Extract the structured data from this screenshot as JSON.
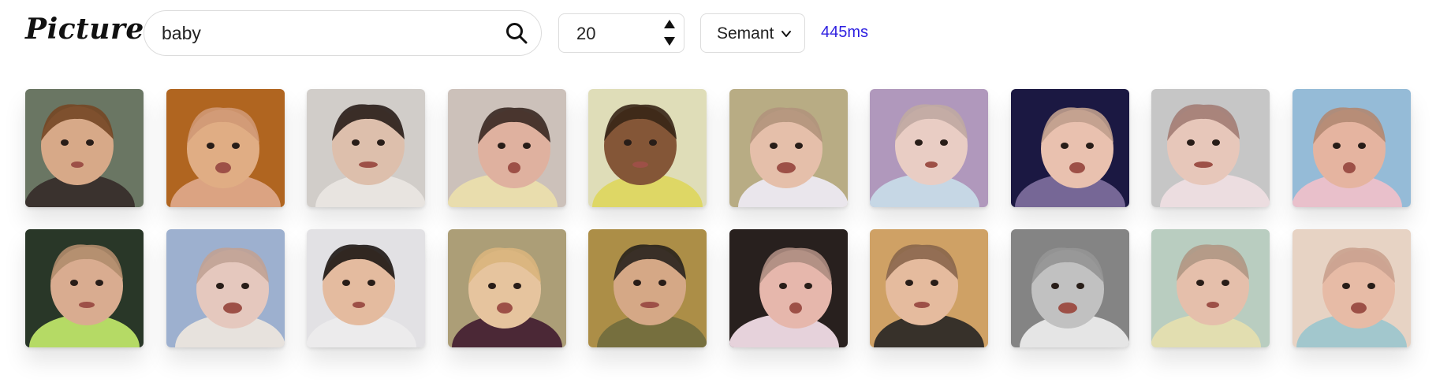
{
  "app": {
    "title": "Pictures"
  },
  "search": {
    "query": "baby",
    "icon": "search-icon"
  },
  "count": {
    "value": "20"
  },
  "mode_select": {
    "selected": "Semant"
  },
  "timing": {
    "text": "445ms",
    "color": "#2d1fe0"
  },
  "results": [
    {
      "bg": "#6f7b68",
      "skin": "#e0b08e",
      "hair": "#7a4a26",
      "cloth": "#3d3530"
    },
    {
      "bg": "#b86a22",
      "skin": "#eab58a",
      "hair": "#d9a07a",
      "cloth": "#e4aa88"
    },
    {
      "bg": "#dad6d2",
      "skin": "#e6c7b3",
      "hair": "#2a1e1a",
      "cloth": "#f2eeea"
    },
    {
      "bg": "#d5c9c2",
      "skin": "#e9b9a6",
      "hair": "#3b2a24",
      "cloth": "#f3e6b5"
    },
    {
      "bg": "#e9e6c0",
      "skin": "#8a5a3a",
      "hair": "#3a2718",
      "cloth": "#e8e06a"
    },
    {
      "bg": "#c0b48a",
      "skin": "#efc7b1",
      "hair": "#b99a82",
      "cloth": "#f4f0f6"
    },
    {
      "bg": "#b89fc4",
      "skin": "#f3d6cc",
      "hair": "#c8b0a8",
      "cloth": "#cfe0ef"
    },
    {
      "bg": "#1d1a45",
      "skin": "#f3c9b7",
      "hair": "#c9a592",
      "cloth": "#7b6c9d"
    },
    {
      "bg": "#cfcfcf",
      "skin": "#f1d0c2",
      "hair": "#a8827a",
      "cloth": "#f6e6ea"
    },
    {
      "bg": "#9cc3e0",
      "skin": "#efbca7",
      "hair": "#b98e78",
      "cloth": "#f3c8d4"
    },
    {
      "bg": "#2b3a2a",
      "skin": "#e2b496",
      "hair": "#b99271",
      "cloth": "#bde36a"
    },
    {
      "bg": "#a4b8d8",
      "skin": "#efd1c6",
      "hair": "#c9a89b",
      "cloth": "#f1ece6"
    },
    {
      "bg": "#ecebee",
      "skin": "#eec3a6",
      "hair": "#1f1815",
      "cloth": "#f6f5f6"
    },
    {
      "bg": "#b4a57c",
      "skin": "#f0cca5",
      "hair": "#e2bc83",
      "cloth": "#4f2a39"
    },
    {
      "bg": "#b4944a",
      "skin": "#deaf8c",
      "hair": "#2a231e",
      "cloth": "#7b7441"
    },
    {
      "bg": "#2a2220",
      "skin": "#f0bfb3",
      "hair": "#b59286",
      "cloth": "#f0dbe4"
    },
    {
      "bg": "#d8a86a",
      "skin": "#efc3a5",
      "hair": "#8f6a50",
      "cloth": "#3a332c"
    },
    {
      "bg": "#8a8a8a",
      "skin": "#c9c9c9",
      "hair": "#9a9a9a",
      "cloth": "#efefef"
    },
    {
      "bg": "#c1d6c8",
      "skin": "#efc7b2",
      "hair": "#b79d8a",
      "cloth": "#ece8b8"
    },
    {
      "bg": "#f1dccc",
      "skin": "#f1c3ad",
      "hair": "#d3a896",
      "cloth": "#a9d0d6"
    }
  ]
}
